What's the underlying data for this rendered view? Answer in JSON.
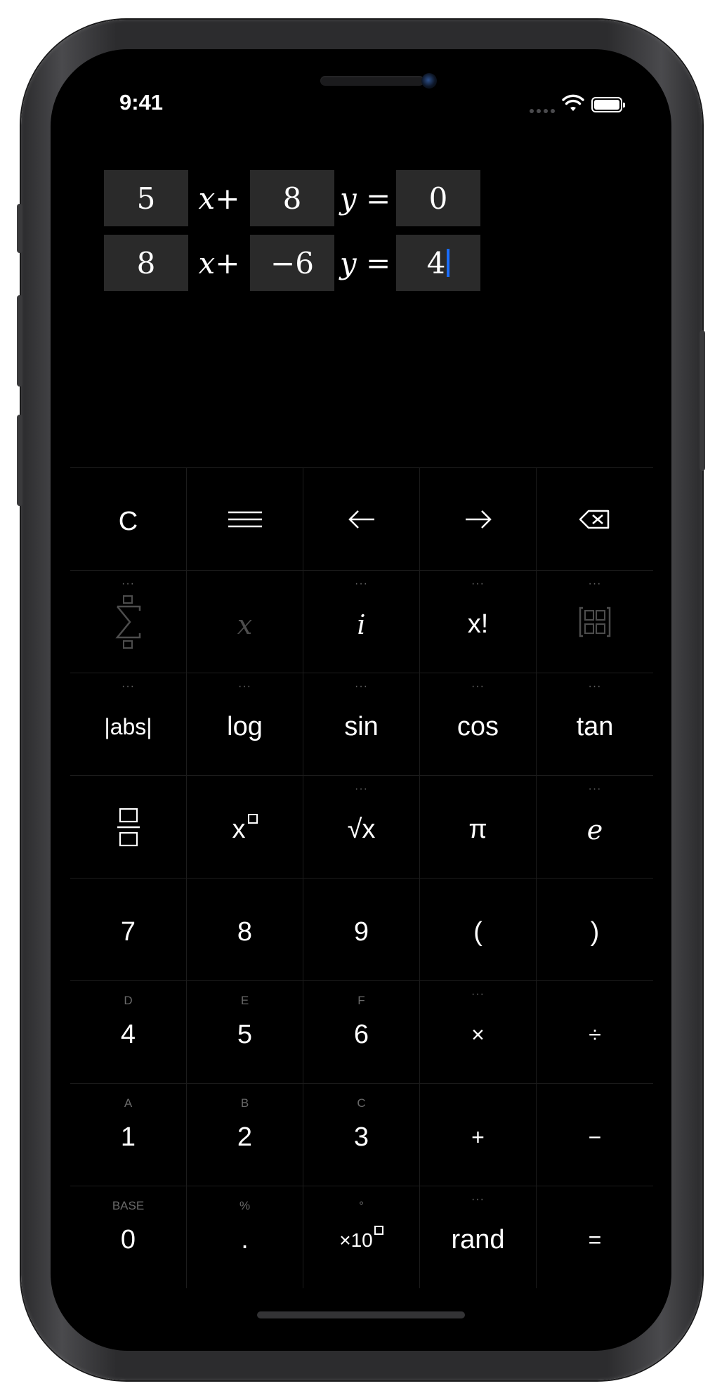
{
  "status_bar": {
    "time": "9:41"
  },
  "equations": [
    {
      "a": "5",
      "op1": "x+",
      "b": "8",
      "op2": "y =",
      "c": "0"
    },
    {
      "a": "8",
      "op1": "x+",
      "b": "−6",
      "op2": "y =",
      "c": "4"
    }
  ],
  "keypad": {
    "row1": {
      "clear": "C",
      "menu_icon": "menu-icon",
      "left_icon": "arrow-left-icon",
      "right_icon": "arrow-right-icon",
      "backspace_icon": "backspace-icon"
    },
    "row2": {
      "sum": "∑",
      "variable": "x",
      "imaginary": "i",
      "factorial": "x!",
      "matrix_icon": "matrix-icon"
    },
    "row3": {
      "abs": "|abs|",
      "log": "log",
      "sin": "sin",
      "cos": "cos",
      "tan": "tan"
    },
    "row4": {
      "fraction_icon": "fraction-icon",
      "power": "x",
      "sqrt": "√x",
      "pi": "π",
      "e": "e"
    },
    "row5": {
      "seven": "7",
      "eight": "8",
      "nine": "9",
      "open_paren": "(",
      "close_paren": ")"
    },
    "row6": {
      "four": "4",
      "four_sub": "D",
      "five": "5",
      "five_sub": "E",
      "six": "6",
      "six_sub": "F",
      "multiply": "×",
      "divide": "÷"
    },
    "row7": {
      "one": "1",
      "one_sub": "A",
      "two": "2",
      "two_sub": "B",
      "three": "3",
      "three_sub": "C",
      "plus": "+",
      "minus": "−"
    },
    "row8": {
      "zero": "0",
      "zero_sub": "BASE",
      "dot": ".",
      "dot_sub": "%",
      "sci": "×10",
      "sci_sub": "°",
      "rand": "rand",
      "equals": "="
    },
    "more_marker": "···"
  },
  "colors": {
    "background": "#000000",
    "key_text": "#ffffff",
    "sub_text": "#6a6a6a",
    "input_box": "#2a2a2a",
    "caret": "#1a6dff"
  }
}
